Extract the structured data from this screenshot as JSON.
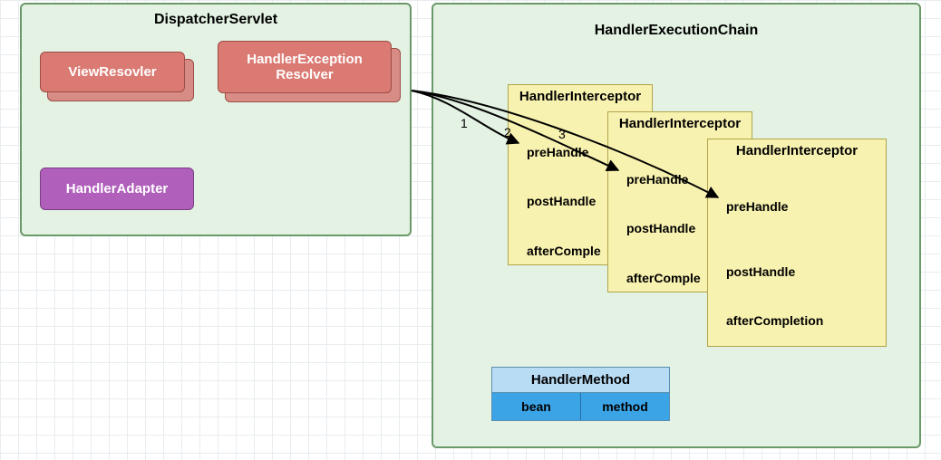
{
  "dispatcher": {
    "title": "DispatcherServlet",
    "viewResolver": "ViewResovler",
    "exceptionResolver": "HandlerException\nResolver",
    "handlerAdapter": "HandlerAdapter"
  },
  "chain": {
    "title": "HandlerExecutionChain",
    "interceptor_title": "HandlerInterceptor",
    "methods": {
      "pre": "preHandle",
      "post": "postHandle",
      "after_short": "afterComple",
      "after_full": "afterCompletion"
    },
    "arrow_labels": {
      "a1": "1",
      "a2": "2",
      "a3": "3"
    }
  },
  "handlerMethod": {
    "title": "HandlerMethod",
    "bean": "bean",
    "method": "method"
  }
}
